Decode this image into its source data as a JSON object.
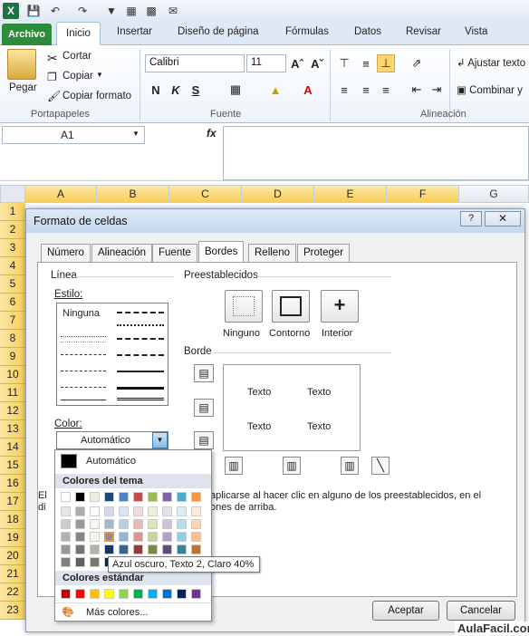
{
  "qat": {
    "icons": [
      "excel-icon",
      "save-icon",
      "undo-icon",
      "redo-icon",
      "filter-icon",
      "borders-icon",
      "grid-icon",
      "mail-icon"
    ]
  },
  "ribbon": {
    "file_tab": "Archivo",
    "tabs": [
      "Inicio",
      "Insertar",
      "Diseño de página",
      "Fórmulas",
      "Datos",
      "Revisar",
      "Vista"
    ],
    "paste": "Pegar",
    "cut": "Cortar",
    "copy": "Copiar",
    "copy_format": "Copiar formato",
    "group_clipboard": "Portapapeles",
    "font_name": "Calibri",
    "font_size": "11",
    "bold": "N",
    "italic": "K",
    "underline": "S",
    "group_font": "Fuente",
    "wrap_text": "Ajustar texto",
    "merge": "Combinar y",
    "group_align": "Alineación"
  },
  "formula_bar": {
    "name_box": "A1",
    "fx": "fx"
  },
  "columns": [
    "A",
    "B",
    "C",
    "D",
    "E",
    "F",
    "G"
  ],
  "rows": [
    "1",
    "2",
    "3",
    "4",
    "5",
    "6",
    "7",
    "8",
    "9",
    "10",
    "11",
    "12",
    "13",
    "14",
    "15",
    "16",
    "17",
    "18",
    "19",
    "20",
    "21",
    "22",
    "23"
  ],
  "dialog": {
    "title": "Formato de celdas",
    "help": "?",
    "tabs": [
      "Número",
      "Alineación",
      "Fuente",
      "Bordes",
      "Relleno",
      "Proteger"
    ],
    "line_section": "Línea",
    "style_label": "Estilo:",
    "style_none": "Ninguna",
    "color_label": "Color:",
    "color_value": "Automático",
    "presets_label": "Preestablecidos",
    "preset_none": "Ninguno",
    "preset_outline": "Contorno",
    "preset_inside": "Interior",
    "border_label": "Borde",
    "preview_text": [
      "Texto",
      "Texto",
      "Texto",
      "Texto"
    ],
    "info_line1_left": "El",
    "info_line1_right": "aplicarse al hacer clic en alguno de los preestablecidos, en el",
    "info_line2_left": "di",
    "info_line2_right": "ones de arriba.",
    "ok": "Aceptar",
    "cancel": "Cancelar"
  },
  "color_popup": {
    "automatic": "Automático",
    "theme_colors": "Colores del tema",
    "standard_colors": "Colores estándar",
    "more_colors": "Más colores...",
    "tooltip": "Azul oscuro, Texto 2, Claro 40%",
    "theme_row": [
      "#ffffff",
      "#000000",
      "#eeece1",
      "#1f497d",
      "#4f81bd",
      "#c0504d",
      "#9bbb59",
      "#8064a2",
      "#4bacc6",
      "#f79646"
    ],
    "standard_row": [
      "#c00000",
      "#ff0000",
      "#ffc000",
      "#ffff00",
      "#92d050",
      "#00b050",
      "#00b0f0",
      "#0070c0",
      "#002060",
      "#7030a0"
    ]
  },
  "watermark": "AulaFacil.com"
}
